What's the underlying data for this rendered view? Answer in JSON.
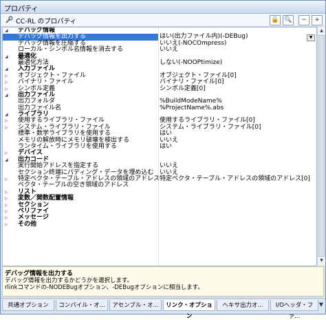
{
  "window": {
    "title": "プロパティ"
  },
  "toolbar": {
    "title": "CC-RL のプロパティ",
    "buttons": [
      "🔒",
      "🔍",
      "−",
      "+"
    ]
  },
  "rows": [
    {
      "type": "cat",
      "label": "デバッグ情報"
    },
    {
      "type": "item",
      "label": "デバッグ情報を出力する",
      "value": "はい(出力ファイル内)(-DEBug)",
      "selected": true
    },
    {
      "type": "item",
      "label": "デバッグ情報を圧縮する",
      "value": "いいえ(-NOCOmpress)"
    },
    {
      "type": "item",
      "label": "ローカル・シンボル名情報を消去する",
      "value": "いいえ"
    },
    {
      "type": "cat",
      "label": "最適化"
    },
    {
      "type": "item",
      "label": "最適化方法",
      "value": "しない(-NOOPtimize)"
    },
    {
      "type": "cat",
      "label": "入力ファイル"
    },
    {
      "type": "sub",
      "label": "オブジェクト・ファイル",
      "value": "オブジェクト・ファイル[0]"
    },
    {
      "type": "sub",
      "label": "バイナリ・ファイル",
      "value": "バイナリ・ファイル[0]"
    },
    {
      "type": "sub",
      "label": "シンボル定義",
      "value": "シンボル定義[0]"
    },
    {
      "type": "cat",
      "label": "出力ファイル"
    },
    {
      "type": "item",
      "label": "出力フォルダ",
      "value": "%BuildModeName%"
    },
    {
      "type": "item",
      "label": "出力ファイル名",
      "value": "%ProjectName%.abs"
    },
    {
      "type": "cat",
      "label": "ライブラリ"
    },
    {
      "type": "sub",
      "label": "使用するライブラリ・ファイル",
      "value": "使用するライブラリ・ファイル[0]"
    },
    {
      "type": "sub",
      "label": "システム・ライブラリ・ファイル",
      "value": "システム・ライブラリ・ファイル[0]"
    },
    {
      "type": "item",
      "label": "標準・数学ライブラリを使用する",
      "value": "はい"
    },
    {
      "type": "item",
      "label": "メモリの解放時にメモリ破壊を検出する",
      "value": "いいえ"
    },
    {
      "type": "item",
      "label": "ランタイム・ライブラリを使用する",
      "value": "はい"
    },
    {
      "type": "ccat",
      "label": "デバイス"
    },
    {
      "type": "cat",
      "label": "出力コード"
    },
    {
      "type": "item",
      "label": "実行開始アドレスを指定する",
      "value": "いいえ"
    },
    {
      "type": "item",
      "label": "セクション終端にパディング・データを埋め込む",
      "value": "いいえ"
    },
    {
      "type": "sub",
      "label": "特定ベクタ・テーブル・アドレスの領域のアドレス",
      "value": "特定ベクタ・テーブル・アドレスの領域のアドレス[0]"
    },
    {
      "type": "item",
      "label": "ベクタ・テーブルの空き領域のアドレス",
      "value": ""
    },
    {
      "type": "ccat",
      "label": "リスト"
    },
    {
      "type": "ccat",
      "label": "変数／関数配置情報"
    },
    {
      "type": "ccat",
      "label": "セクション"
    },
    {
      "type": "ccat",
      "label": "ベリファイ"
    },
    {
      "type": "ccat",
      "label": "メッセージ"
    },
    {
      "type": "ccat",
      "label": "その他"
    }
  ],
  "description": {
    "title": "デバッグ情報を出力する",
    "lines": [
      "デバッグ情報を出力するかどうかを選択します。",
      "rlinkコマンドの-NODEBugオプション、-DEBugオプションに相当します。"
    ]
  },
  "tabs": [
    {
      "label": "共通オプション",
      "active": false
    },
    {
      "label": "コンパイル・オ...",
      "active": false
    },
    {
      "label": "アセンブル・オ...",
      "active": false
    },
    {
      "label": "リンク・オプション",
      "active": true
    },
    {
      "label": "ヘキサ出力オ...",
      "active": false
    },
    {
      "label": "I/Oヘッダ・ファ...",
      "active": false
    }
  ]
}
